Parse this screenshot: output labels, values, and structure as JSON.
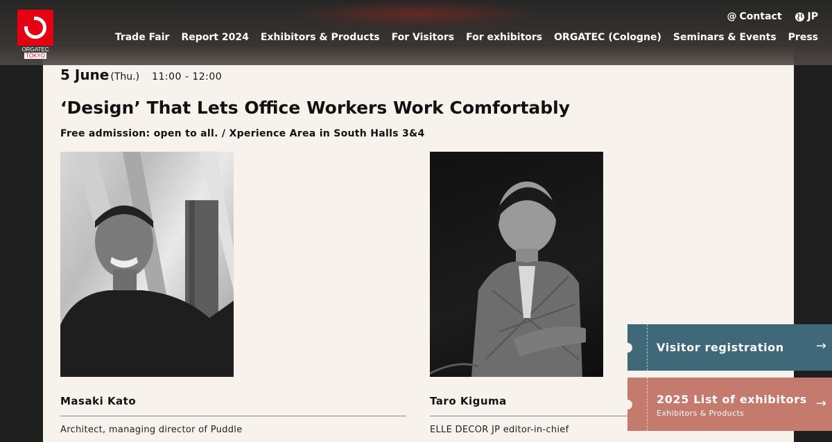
{
  "header": {
    "logo": {
      "brand": "ORGATEC",
      "city": "TOKYO"
    },
    "util": {
      "contact": "Contact",
      "lang": "JP"
    },
    "nav": [
      "Trade Fair",
      "Report 2024",
      "Exhibitors & Products",
      "For Visitors",
      "For exhibitors",
      "ORGATEC (Cologne)",
      "Seminars & Events",
      "Press"
    ]
  },
  "event": {
    "date": "5 June",
    "dow": "(Thu.)",
    "time": "11:00 - 12:00",
    "title": "‘Design’ That Lets Office Workers Work Comfortably",
    "subtitle": "Free admission: open to all. / Xperience Area in South Halls 3&4"
  },
  "speakers": [
    {
      "name": "Masaki Kato",
      "role": "Architect, managing director of Puddle"
    },
    {
      "name": "Taro Kiguma",
      "role": "ELLE DECOR JP editor-in-chief"
    }
  ],
  "cta": {
    "visitor": {
      "label": "Visitor registration"
    },
    "exhibitors": {
      "label": "2025 List of exhibitors",
      "sub": "Exhibitors & Products"
    }
  },
  "colors": {
    "brand_red": "#e60012",
    "cta_teal": "#3f6878",
    "cta_salmon": "#c47b6e",
    "page_bg": "#f7f3ec"
  }
}
